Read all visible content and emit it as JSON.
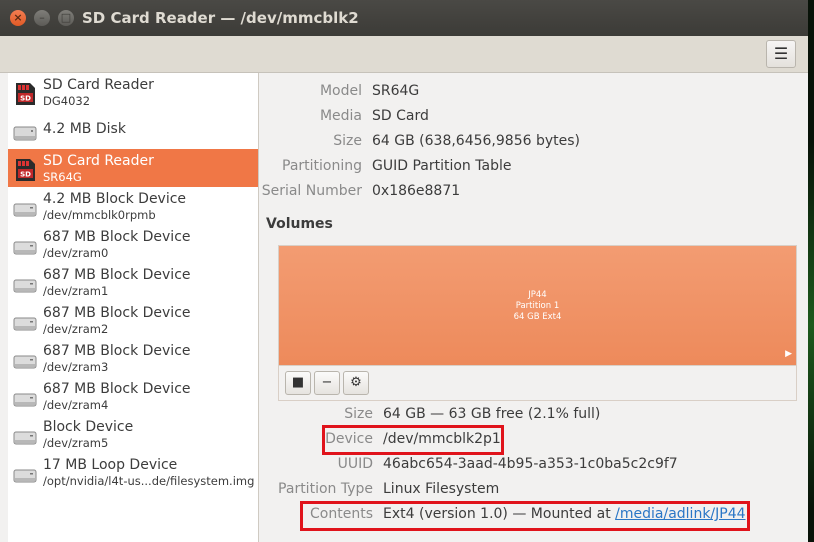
{
  "window": {
    "title": "SD Card Reader — /dev/mmcblk2",
    "close_glyph": "×",
    "min_glyph": "–",
    "max_glyph": "□",
    "menu_glyph": "☰"
  },
  "devices": [
    {
      "name": "SD Card Reader",
      "sub": "DG4032",
      "icon": "sdcard-icon",
      "selected": false
    },
    {
      "name": "4.2 MB Disk",
      "sub": "",
      "icon": "disk-icon",
      "selected": false
    },
    {
      "name": "SD Card Reader",
      "sub": "SR64G",
      "icon": "sdcard-icon",
      "selected": true
    },
    {
      "name": "4.2 MB Block Device",
      "sub": "/dev/mmcblk0rpmb",
      "icon": "drive-icon",
      "selected": false
    },
    {
      "name": "687 MB Block Device",
      "sub": "/dev/zram0",
      "icon": "drive-icon",
      "selected": false
    },
    {
      "name": "687 MB Block Device",
      "sub": "/dev/zram1",
      "icon": "drive-icon",
      "selected": false
    },
    {
      "name": "687 MB Block Device",
      "sub": "/dev/zram2",
      "icon": "drive-icon",
      "selected": false
    },
    {
      "name": "687 MB Block Device",
      "sub": "/dev/zram3",
      "icon": "drive-icon",
      "selected": false
    },
    {
      "name": "687 MB Block Device",
      "sub": "/dev/zram4",
      "icon": "drive-icon",
      "selected": false
    },
    {
      "name": "Block Device",
      "sub": "/dev/zram5",
      "icon": "drive-icon",
      "selected": false
    },
    {
      "name": "17 MB Loop Device",
      "sub": "/opt/nvidia/l4t-us...de/filesystem.img",
      "icon": "drive-icon",
      "selected": false
    }
  ],
  "drive": {
    "model_label": "Model",
    "model": "SR64G",
    "media_label": "Media",
    "media": "SD Card",
    "size_label": "Size",
    "size": "64 GB (638,6456,9856 bytes)",
    "partitioning_label": "Partitioning",
    "partitioning": "GUID Partition Table",
    "serial_label": "Serial Number",
    "serial": "0x186e8871"
  },
  "volumes": {
    "heading": "Volumes",
    "partition": {
      "name": "JP44",
      "number": "Partition 1",
      "desc": "64 GB Ext4"
    },
    "play_glyph": "▶",
    "stop_glyph": "■",
    "minus_glyph": "−",
    "gear_glyph": "⚙"
  },
  "volume_props": {
    "size_label": "Size",
    "size": "64 GB — 63 GB free (2.1% full)",
    "device_label": "Device",
    "device": "/dev/mmcblk2p1",
    "uuid_label": "UUID",
    "uuid": "46abc654-3aad-4b95-a353-1c0ba5c2c9f7",
    "ptype_label": "Partition Type",
    "ptype": "Linux Filesystem",
    "contents_label": "Contents",
    "contents_prefix": "Ext4 (version 1.0) — Mounted at ",
    "mount_link": "/media/adlink/JP44"
  },
  "colors": {
    "accent": "#f07746",
    "highlight": "#e0131b",
    "link": "#2a76c6"
  }
}
